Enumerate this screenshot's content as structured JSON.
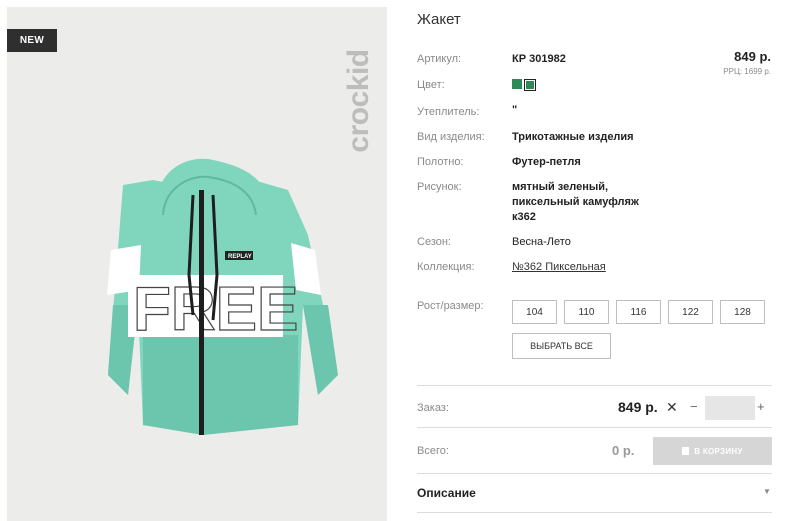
{
  "badge": "NEW",
  "brand": "crockid",
  "product": {
    "title": "Жакет",
    "price": "849 р.",
    "rrp": "РРЦ: 1699 р."
  },
  "specs": [
    {
      "label": "Артикул:",
      "value": "КР 301982"
    },
    {
      "label": "Цвет:",
      "value": ""
    },
    {
      "label": "Утеплитель:",
      "value": "\""
    },
    {
      "label": "Вид изделия:",
      "value": "Трикотажные изделия"
    },
    {
      "label": "Полотно:",
      "value": "Футер-петля"
    },
    {
      "label": "Рисунок:",
      "value": "мятный зеленый, пиксельный камуфляж к362"
    },
    {
      "label": "Сезон:",
      "value": "Весна-Лето"
    },
    {
      "label": "Коллекция:",
      "value": "№362 Пиксельная"
    }
  ],
  "colors": [
    "#2e8b57",
    "#2e8b57"
  ],
  "size_label": "Рост/размер:",
  "sizes": [
    "104",
    "110",
    "116",
    "122",
    "128"
  ],
  "select_all": "ВЫБРАТЬ ВСЕ",
  "order": {
    "label": "Заказ:",
    "price": "849 р.",
    "times": "✕",
    "minus": "−",
    "plus": "+"
  },
  "total": {
    "label": "Всего:",
    "value": "0 р."
  },
  "cart_button": "В КОРЗИНУ",
  "description": {
    "label": "Описание",
    "chevron": "▼"
  },
  "garment_print": {
    "word": "FREE",
    "label": "REPLAY"
  }
}
